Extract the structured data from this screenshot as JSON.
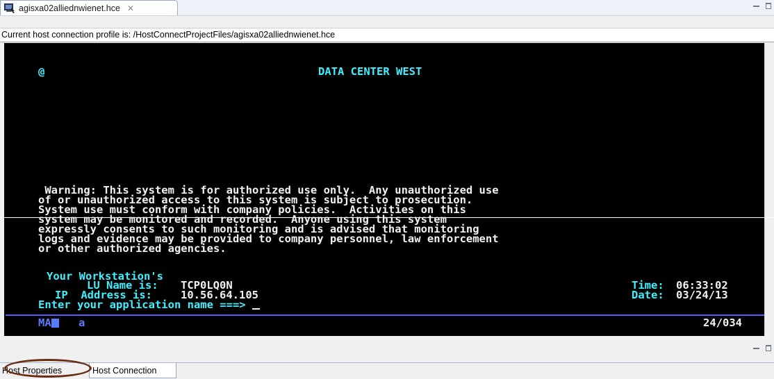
{
  "editor_tab": {
    "title": "agisxa02alliednwienet.hce",
    "icon": "terminal-icon",
    "close_glyph": "✕"
  },
  "profile_line": "Current host connection profile is: /HostConnectProjectFiles/agisxa02alliednwienet.hce",
  "terminal": {
    "at_sign": "@",
    "banner": "DATA CENTER WEST",
    "warning_lines": [
      " Warning: This system is for authorized use only.  Any unauthorized use",
      "of or unauthorized access to this system is subject to prosecution.",
      "System use must conform with company policies.  Activities on this",
      "system may be monitored and recorded.  Anyone using this system",
      "expressly consents to such monitoring and is advised that monitoring",
      "logs and evidence may be provided to company personnel, law enforcement",
      "or other authorized agencies."
    ],
    "workstation_label": "Your Workstation's",
    "lu_label": "LU Name is:",
    "lu_value": "TCP0LQ0N",
    "ip_label": "IP  Address is:",
    "ip_value": "10.56.64.105",
    "time_label": "Time:",
    "time_value": "06:33:02",
    "date_label": "Date:",
    "date_value": "03/24/13",
    "prompt": "Enter your application name ===>",
    "status_left": "MA",
    "status_a": "a",
    "status_pos": "24/034"
  },
  "bottom_tabs": [
    {
      "label": "Host Properties"
    },
    {
      "label": "Host Connection"
    }
  ],
  "colors": {
    "terminal_bg": "#000000",
    "terminal_cyan": "#40f0ff",
    "terminal_white": "#f2f2f2",
    "terminal_blue": "#5a7cff",
    "annotation_oval": "#6b2d11"
  }
}
